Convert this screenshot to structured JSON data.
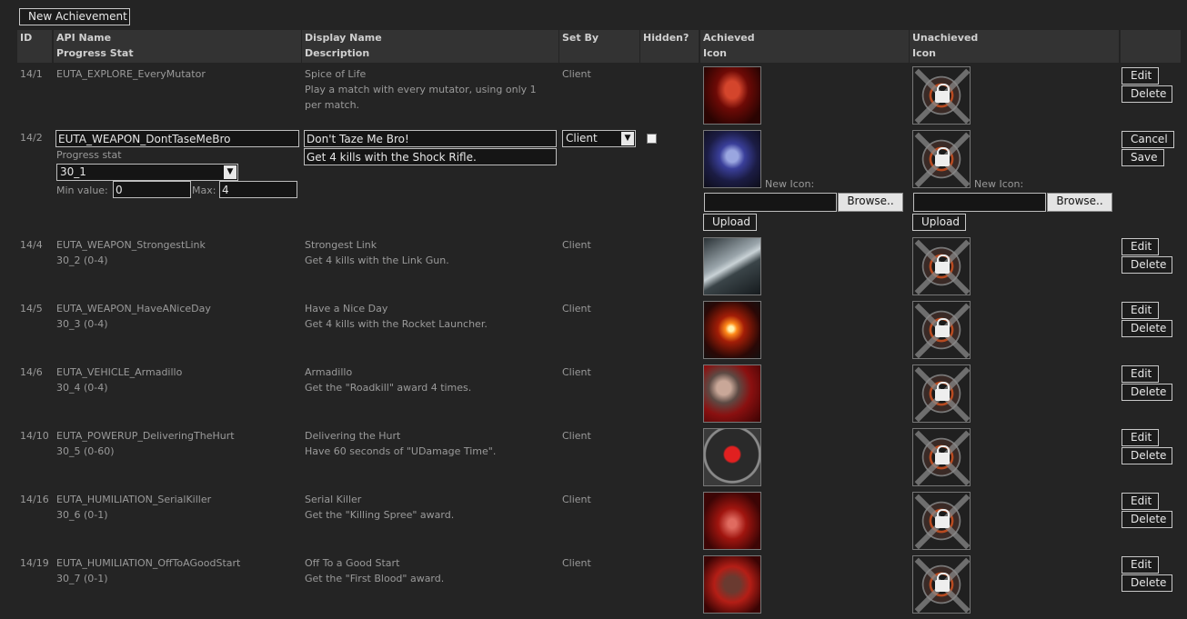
{
  "toolbar": {
    "new_achievement": "New Achievement"
  },
  "headers": {
    "id": "ID",
    "api_name": "API Name",
    "progress_stat": "Progress Stat",
    "display_name": "Display Name",
    "description": "Description",
    "set_by": "Set By",
    "hidden": "Hidden?",
    "achieved": "Achieved",
    "achieved_icon": "Icon",
    "unachieved": "Unachieved",
    "unachieved_icon": "Icon"
  },
  "buttons": {
    "edit": "Edit",
    "delete": "Delete",
    "cancel": "Cancel",
    "save": "Save",
    "browse": "Browse..",
    "upload": "Upload"
  },
  "rows": [
    {
      "id": "14/1",
      "api": "EUTA_EXPLORE_EveryMutator",
      "stat": "",
      "name": "Spice of Life",
      "desc1": "Play a match with every mutator, using only 1",
      "desc2": "per match.",
      "set_by": "Client"
    },
    {
      "id": "14/4",
      "api": "EUTA_WEAPON_StrongestLink",
      "stat": "30_2 (0-4)",
      "name": "Strongest Link",
      "desc1": "Get 4 kills with the Link Gun.",
      "desc2": "",
      "set_by": "Client"
    },
    {
      "id": "14/5",
      "api": "EUTA_WEAPON_HaveANiceDay",
      "stat": "30_3 (0-4)",
      "name": "Have a Nice Day",
      "desc1": "Get 4 kills with the Rocket Launcher.",
      "desc2": "",
      "set_by": "Client"
    },
    {
      "id": "14/6",
      "api": "EUTA_VEHICLE_Armadillo",
      "stat": "30_4 (0-4)",
      "name": "Armadillo",
      "desc1": "Get the \"Roadkill\" award 4 times.",
      "desc2": "",
      "set_by": "Client"
    },
    {
      "id": "14/10",
      "api": "EUTA_POWERUP_DeliveringTheHurt",
      "stat": "30_5 (0-60)",
      "name": "Delivering the Hurt",
      "desc1": "Have 60 seconds of \"UDamage Time\".",
      "desc2": "",
      "set_by": "Client"
    },
    {
      "id": "14/16",
      "api": "EUTA_HUMILIATION_SerialKiller",
      "stat": "30_6 (0-1)",
      "name": "Serial Killer",
      "desc1": "Get the \"Killing Spree\" award.",
      "desc2": "",
      "set_by": "Client"
    },
    {
      "id": "14/19",
      "api": "EUTA_HUMILIATION_OffToAGoodStart",
      "stat": "30_7 (0-1)",
      "name": "Off To a Good Start",
      "desc1": "Get the \"First Blood\" award.",
      "desc2": "",
      "set_by": "Client"
    }
  ],
  "edit_row": {
    "id": "14/2",
    "api_value": "EUTA_WEAPON_DontTaseMeBro",
    "progress_label": "Progress stat",
    "progress_value": "30_1",
    "min_label": "Min value:",
    "min_value": "0",
    "max_label": "Max:",
    "max_value": "4",
    "name_value": "Don't Taze Me Bro!",
    "desc_value": "Get 4 kills with the Shock Rifle.",
    "set_by_value": "Client",
    "new_icon_label": "New Icon:"
  }
}
